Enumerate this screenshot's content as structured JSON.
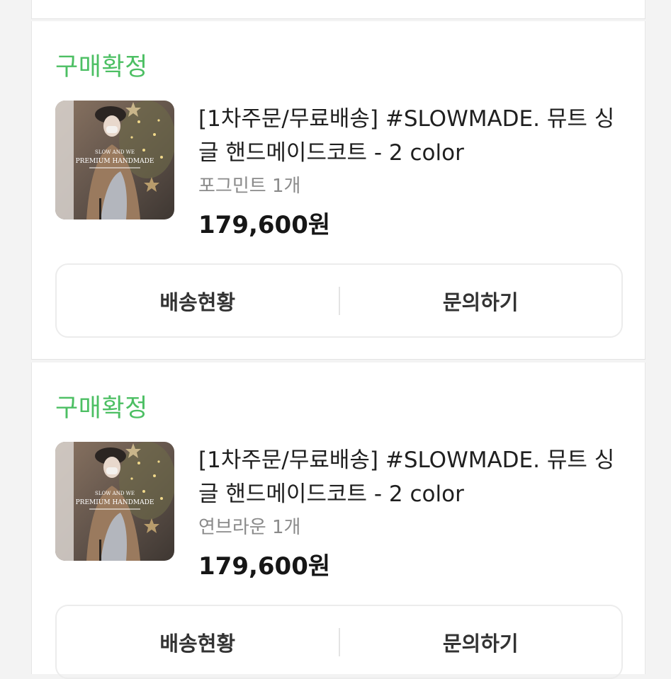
{
  "colors": {
    "status_green": "#4cbf63"
  },
  "orders": [
    {
      "status": "구매확정",
      "product": {
        "title": "[1차주문/무료배송] #SLOWMADE. 뮤트 싱글 핸드메이드코트 - 2 color",
        "option": "포그민트 1개",
        "price": "179,600원",
        "thumb_text": [
          "SLOW AND WE",
          "PREMIUM HANDMADE"
        ]
      },
      "actions": {
        "shipping": "배송현황",
        "inquiry": "문의하기"
      }
    },
    {
      "status": "구매확정",
      "product": {
        "title": "[1차주문/무료배송] #SLOWMADE. 뮤트 싱글 핸드메이드코트 - 2 color",
        "option": "연브라운 1개",
        "price": "179,600원",
        "thumb_text": [
          "SLOW AND WE",
          "PREMIUM HANDMADE"
        ]
      },
      "actions": {
        "shipping": "배송현황",
        "inquiry": "문의하기"
      }
    }
  ]
}
